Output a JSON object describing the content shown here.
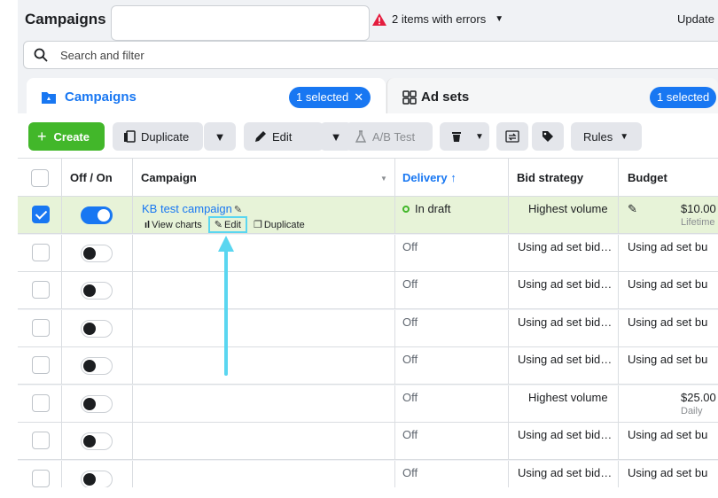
{
  "header": {
    "title": "Campaigns",
    "errors_text": "2 items with errors",
    "update_text": "Update"
  },
  "search": {
    "placeholder": "Search and filter"
  },
  "tabs": [
    {
      "label": "Campaigns",
      "badge": "1 selected",
      "active": true
    },
    {
      "label": "Ad sets",
      "badge": "1 selected",
      "active": false
    }
  ],
  "toolbar": {
    "create": "Create",
    "duplicate": "Duplicate",
    "edit": "Edit",
    "ab_test": "A/B Test",
    "rules": "Rules"
  },
  "table": {
    "columns": [
      "Off / On",
      "Campaign",
      "Delivery ↑",
      "Bid strategy",
      "Budget"
    ],
    "rows": [
      {
        "selected": true,
        "on": true,
        "campaign": "KB test campaign",
        "delivery": "In draft",
        "bid": "Highest volume",
        "budget": "$10.00",
        "budget_sub": "Lifetime"
      },
      {
        "selected": false,
        "on": false,
        "campaign": "",
        "delivery": "Off",
        "bid": "Using ad set bid…",
        "budget": "Using ad set bu",
        "budget_sub": ""
      },
      {
        "selected": false,
        "on": false,
        "campaign": "",
        "delivery": "Off",
        "bid": "Using ad set bid…",
        "budget": "Using ad set bu",
        "budget_sub": ""
      },
      {
        "selected": false,
        "on": false,
        "campaign": "",
        "delivery": "Off",
        "bid": "Using ad set bid…",
        "budget": "Using ad set bu",
        "budget_sub": ""
      },
      {
        "selected": false,
        "on": false,
        "campaign": "",
        "delivery": "Off",
        "bid": "Using ad set bid…",
        "budget": "Using ad set bu",
        "budget_sub": ""
      },
      {
        "selected": false,
        "on": false,
        "campaign": "",
        "delivery": "Off",
        "bid": "Highest volume",
        "budget": "$25.00",
        "budget_sub": "Daily"
      },
      {
        "selected": false,
        "on": false,
        "campaign": "",
        "delivery": "Off",
        "bid": "Using ad set bid…",
        "budget": "Using ad set bu",
        "budget_sub": ""
      },
      {
        "selected": false,
        "on": false,
        "campaign": "",
        "delivery": "Off",
        "bid": "Using ad set bid…",
        "budget": "Using ad set bu",
        "budget_sub": ""
      }
    ],
    "row_actions": {
      "view_charts": "View charts",
      "edit": "Edit",
      "duplicate": "Duplicate"
    }
  },
  "colors": {
    "accent": "#1877f2",
    "create_green": "#42b72a",
    "selected_row": "#e7f3d8",
    "highlight": "#5ad6f0"
  }
}
